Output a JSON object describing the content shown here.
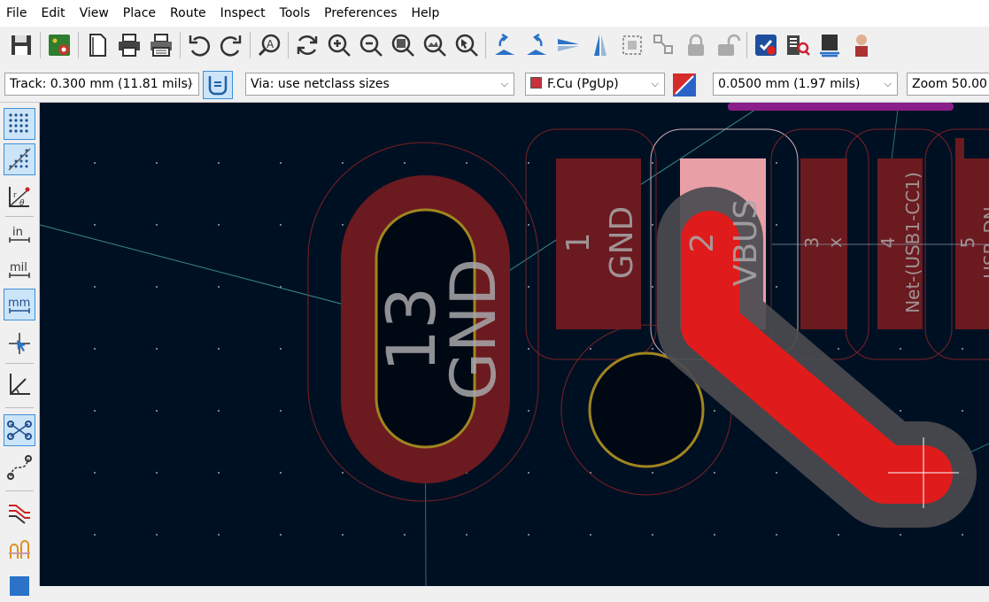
{
  "menu": [
    "File",
    "Edit",
    "View",
    "Place",
    "Route",
    "Inspect",
    "Tools",
    "Preferences",
    "Help"
  ],
  "aux": {
    "track_width": "Track: 0.300 mm (11.81 mils)",
    "via_size": "Via: use netclass sizes",
    "layer": "F.Cu (PgUp)",
    "grid": "0.0500 mm (1.97 mils)",
    "zoom": "Zoom 50.00"
  },
  "left_toolbar": {
    "in_label": "in",
    "mil_label": "mil",
    "mm_label": "mm"
  },
  "board": {
    "pad_13_number": "13",
    "pad_13_net": "GND",
    "pad_1_number": "1",
    "pad_1_net": "GND",
    "pad_2_number": "2",
    "pad_2_net": "VBUS",
    "pad_3_number": "3",
    "pad_3_net": "x",
    "pad_4_number": "4",
    "pad_4_net": "Net-(USB1-CC1)",
    "pad_5_number": "5",
    "pad_5_net": "USB_DN"
  },
  "colors": {
    "canvas_bg": "#001023",
    "pad": "#6b1a1f",
    "pad_highlight": "#e8a0a6",
    "track": "#e01b1b",
    "clearance": "#5a5a5e",
    "hole_ring": "#a08520",
    "courtyard": "#7a2025",
    "accent": "#3c8fd6"
  }
}
